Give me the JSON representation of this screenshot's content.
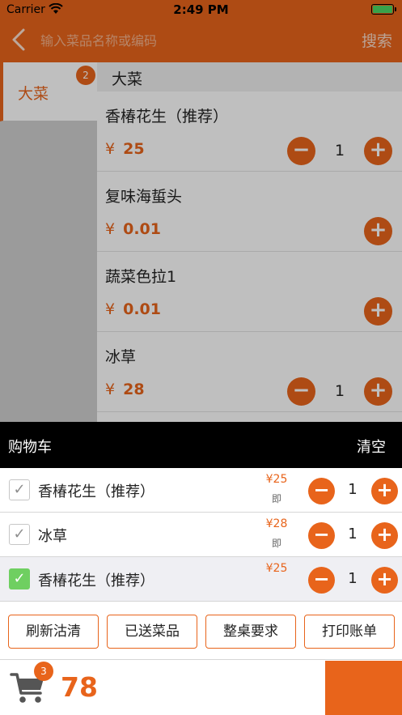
{
  "status": {
    "carrier": "Carrier",
    "time": "2:49 PM"
  },
  "nav": {
    "search_placeholder": "输入菜品名称或编码",
    "search_label": "搜索"
  },
  "categories": [
    {
      "label": "大菜",
      "badge": "2"
    }
  ],
  "section_title": "大菜",
  "dishes": [
    {
      "name": "香椿花生（推荐）",
      "currency": "¥",
      "price": "25",
      "qty": "1"
    },
    {
      "name": "复味海蜇头",
      "currency": "¥",
      "price": "0.01"
    },
    {
      "name": "蔬菜色拉1",
      "currency": "¥",
      "price": "0.01"
    },
    {
      "name": "冰草",
      "currency": "¥",
      "price": "28",
      "qty": "1"
    }
  ],
  "cart": {
    "title": "购物车",
    "clear_label": "清空",
    "items": [
      {
        "name": "香椿花生（推荐）",
        "price": "¥25",
        "note": "即",
        "qty": "1",
        "checked": false
      },
      {
        "name": "冰草",
        "price": "¥28",
        "note": "即",
        "qty": "1",
        "checked": false
      },
      {
        "name": "香椿花生（推荐）",
        "price": "¥25",
        "qty": "1",
        "checked": true
      }
    ]
  },
  "actions": [
    "刷新沽清",
    "已送菜品",
    "整桌要求",
    "打印账单"
  ],
  "bottom": {
    "cart_count": "3",
    "total": "78"
  },
  "colors": {
    "accent": "#e8641b",
    "check_on": "#6fcf61"
  },
  "icons": {
    "back": "chevron-left-icon",
    "cart": "shopping-cart-icon",
    "check": "checkmark-icon"
  }
}
